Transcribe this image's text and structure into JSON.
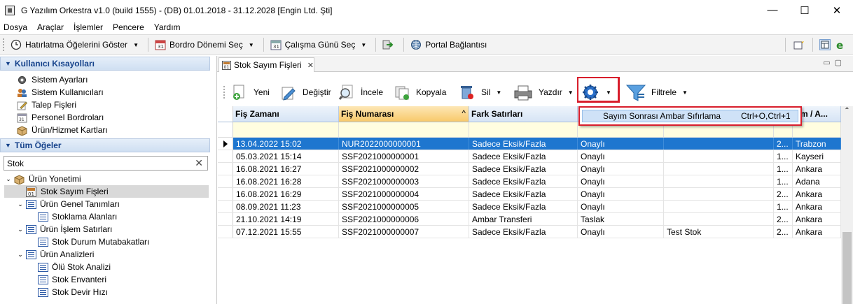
{
  "window": {
    "title": "G Yazılım Orkestra v1.0 (build 1555) - (DB) 01.01.2018 - 31.12.2028 [Engin Ltd. Şti]",
    "controls": [
      "—",
      "☐",
      "✕"
    ]
  },
  "menu": [
    "Dosya",
    "Araçlar",
    "İşlemler",
    "Pencere",
    "Yardım"
  ],
  "toolbar": {
    "reminder": "Hatırlatma Öğelerini Göster",
    "payroll": "Bordro Dönemi Seç",
    "workday": "Çalışma Günü Seç",
    "portal": "Portal Bağlantısı"
  },
  "shortcuts": {
    "header": "Kullanıcı Kısayolları",
    "items": [
      "Sistem Ayarları",
      "Sistem Kullanıcıları",
      "Talep Fişleri",
      "Personel Bordroları",
      "Ürün/Hizmet Kartları"
    ]
  },
  "all_items": {
    "header": "Tüm Öğeler",
    "search_value": "Stok",
    "clear": "✕"
  },
  "tree": [
    {
      "label": "Ürün Yonetimi",
      "level": 0,
      "expand": "⌄",
      "icon": "box-icon"
    },
    {
      "label": "Stok Sayım Fişleri",
      "level": 1,
      "expand": "",
      "icon": "form-icon",
      "selected": true
    },
    {
      "label": "Ürün Genel Tanımları",
      "level": 1,
      "expand": "⌄",
      "icon": "list-icon"
    },
    {
      "label": "Stoklama Alanları",
      "level": 2,
      "expand": "",
      "icon": "list-icon"
    },
    {
      "label": "Ürün İşlem Satırları",
      "level": 1,
      "expand": "⌄",
      "icon": "list-icon"
    },
    {
      "label": "Stok Durum Mutabakatları",
      "level": 2,
      "expand": "",
      "icon": "list-icon"
    },
    {
      "label": "Ürün Analizleri",
      "level": 1,
      "expand": "⌄",
      "icon": "list-icon"
    },
    {
      "label": "Ölü Stok Analizi",
      "level": 2,
      "expand": "",
      "icon": "list-icon"
    },
    {
      "label": "Stok Envanteri",
      "level": 2,
      "expand": "",
      "icon": "list-icon"
    },
    {
      "label": "Stok Devir Hızı",
      "level": 2,
      "expand": "",
      "icon": "list-icon"
    }
  ],
  "tab": {
    "label": "Stok Sayım Fişleri",
    "close": "✕"
  },
  "actions": {
    "new": "Yeni",
    "edit": "Değiştir",
    "inspect": "İncele",
    "copy": "Kopyala",
    "delete": "Sil",
    "print": "Yazdır",
    "filter": "Filtrele"
  },
  "dropdown": {
    "label": "Sayım Sonrası Ambar Sıfırlama",
    "shortcut": "Ctrl+O,Ctrl+1"
  },
  "grid": {
    "headers": [
      "Fiş Zamanı",
      "Fiş Numarası",
      "Fark Satırları",
      "",
      "",
      "",
      "rim / A..."
    ],
    "rows": [
      [
        "13.04.2022 15:02",
        "NUR2022000000001",
        "Sadece Eksik/Fazla",
        "Onaylı",
        "",
        "2...",
        "Trabzon"
      ],
      [
        "05.03.2021 15:14",
        "SSF2021000000001",
        "Sadece Eksik/Fazla",
        "Onaylı",
        "",
        "1...",
        "Kayseri"
      ],
      [
        "16.08.2021 16:27",
        "SSF2021000000002",
        "Sadece Eksik/Fazla",
        "Onaylı",
        "",
        "1...",
        "Ankara"
      ],
      [
        "16.08.2021 16:28",
        "SSF2021000000003",
        "Sadece Eksik/Fazla",
        "Onaylı",
        "",
        "1...",
        "Adana"
      ],
      [
        "16.08.2021 16:29",
        "SSF2021000000004",
        "Sadece Eksik/Fazla",
        "Onaylı",
        "",
        "2...",
        "Ankara"
      ],
      [
        "08.09.2021 11:23",
        "SSF2021000000005",
        "Sadece Eksik/Fazla",
        "Onaylı",
        "",
        "1...",
        "Ankara"
      ],
      [
        "21.10.2021 14:19",
        "SSF2021000000006",
        "Ambar Transferi",
        "Taslak",
        "",
        "2...",
        "Ankara"
      ],
      [
        "07.12.2021 15:55",
        "SSF2021000000007",
        "Sadece Eksik/Fazla",
        "Onaylı",
        "Test Stok",
        "2...",
        "Ankara"
      ]
    ]
  }
}
